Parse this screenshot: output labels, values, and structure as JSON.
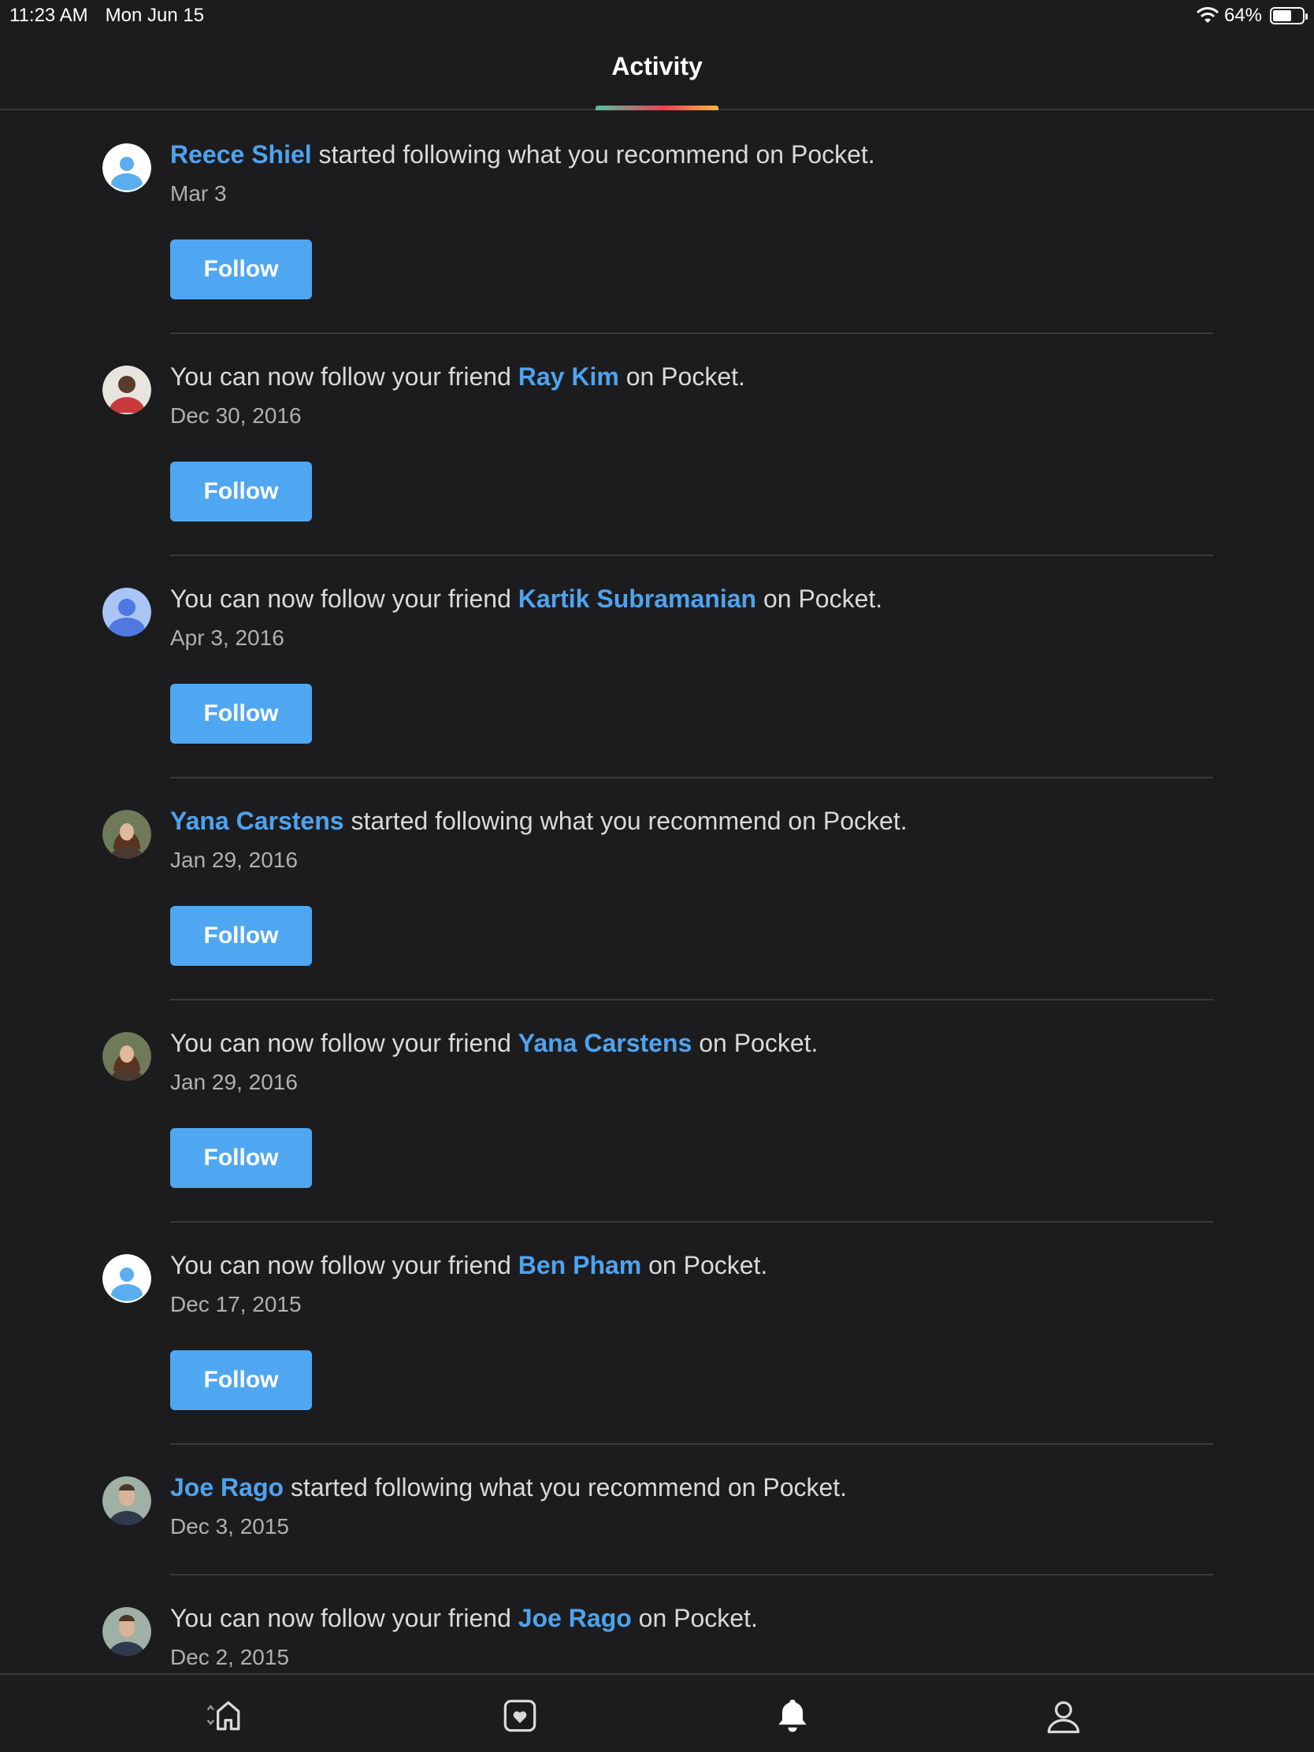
{
  "status_bar": {
    "time": "11:23 AM",
    "date": "Mon Jun 15",
    "battery": "64%",
    "battery_level": 0.64
  },
  "header": {
    "title": "Activity"
  },
  "feed": [
    {
      "name": "Reece Shiel",
      "before": "",
      "after": " started following what you recommend on Pocket.",
      "date": "Mar 3",
      "button": "Follow",
      "avatar": "default-blue-light"
    },
    {
      "name": "Ray Kim",
      "before": "You can now follow your friend ",
      "after": " on Pocket.",
      "date": "Dec 30, 2016",
      "button": "Follow",
      "avatar": "photo-red"
    },
    {
      "name": "Kartik Subramanian",
      "before": "You can now follow your friend ",
      "after": " on Pocket.",
      "date": "Apr 3, 2016",
      "button": "Follow",
      "avatar": "default-blue-dark"
    },
    {
      "name": "Yana Carstens",
      "before": "",
      "after": " started following what you recommend on Pocket.",
      "date": "Jan 29, 2016",
      "button": "Follow",
      "avatar": "photo-woman"
    },
    {
      "name": "Yana Carstens",
      "before": "You can now follow your friend ",
      "after": " on Pocket.",
      "date": "Jan 29, 2016",
      "button": "Follow",
      "avatar": "photo-woman"
    },
    {
      "name": "Ben Pham",
      "before": "You can now follow your friend ",
      "after": " on Pocket.",
      "date": "Dec 17, 2015",
      "button": "Follow",
      "avatar": "default-blue-light"
    },
    {
      "name": "Joe Rago",
      "before": "",
      "after": " started following what you recommend on Pocket.",
      "date": "Dec 3, 2015",
      "button": "",
      "avatar": "photo-man"
    },
    {
      "name": "Joe Rago",
      "before": "You can now follow your friend ",
      "after": " on Pocket.",
      "date": "Dec 2, 2015",
      "button": "",
      "avatar": "photo-man"
    }
  ],
  "tab_bar": {
    "items": [
      "home-icon",
      "saves-icon",
      "bell-icon",
      "profile-icon"
    ],
    "active": "bell-icon"
  },
  "colors": {
    "accent": "#50a7f1",
    "link": "#4ea3ef",
    "background": "#1c1c1e"
  }
}
